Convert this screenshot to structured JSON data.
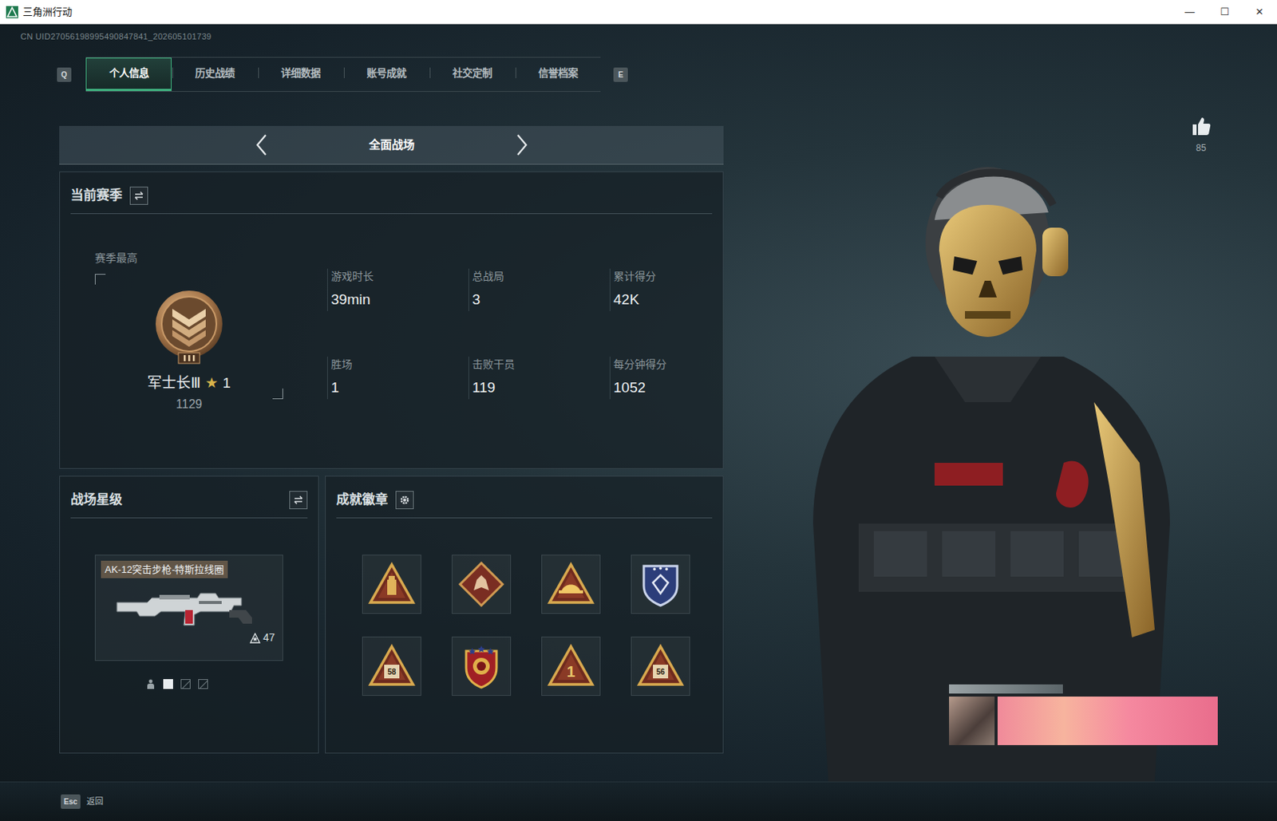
{
  "window": {
    "title": "三角洲行动",
    "controls": [
      "—",
      "☐",
      "✕"
    ]
  },
  "uid": "CN UID27056198995490847841_202605101739",
  "tabs": {
    "prev_key": "Q",
    "next_key": "E",
    "items": [
      {
        "label": "个人信息",
        "selected": true
      },
      {
        "label": "历史战绩",
        "selected": false
      },
      {
        "label": "详细数据",
        "selected": false
      },
      {
        "label": "账号成就",
        "selected": false
      },
      {
        "label": "社交定制",
        "selected": false
      },
      {
        "label": "信誉档案",
        "selected": false
      }
    ]
  },
  "mode": {
    "label": "全面战场"
  },
  "season": {
    "title": "当前赛季",
    "best_label": "赛季最高",
    "rank": "军士长Ⅲ",
    "rank_star_glyph": "★",
    "rank_star_count": "1",
    "score": "1129",
    "stats": [
      {
        "label": "游戏时长",
        "value": "39min"
      },
      {
        "label": "总战局",
        "value": "3"
      },
      {
        "label": "累计得分",
        "value": "42K"
      },
      {
        "label": "胜场",
        "value": "1"
      },
      {
        "label": "击败干员",
        "value": "119"
      },
      {
        "label": "每分钟得分",
        "value": "1052"
      }
    ]
  },
  "star_level": {
    "title": "战场星级",
    "weapon": "AK-12突击步枪-特斯拉线圈",
    "star_count": "47",
    "pages": [
      {
        "kind": "person",
        "selected": false
      },
      {
        "kind": "square",
        "selected": true
      },
      {
        "kind": "square",
        "selected": false
      },
      {
        "kind": "square",
        "selected": false
      }
    ]
  },
  "badges": {
    "title": "成就徽章",
    "items": [
      {
        "kind": "triangle-bottle"
      },
      {
        "kind": "diamond"
      },
      {
        "kind": "triangle-hat"
      },
      {
        "kind": "shield"
      },
      {
        "kind": "triangle-small-text",
        "text": "58"
      },
      {
        "kind": "crest"
      },
      {
        "kind": "triangle-big-text",
        "text": "1"
      },
      {
        "kind": "triangle-small-text",
        "text": "56"
      }
    ]
  },
  "likes": {
    "count": "85"
  },
  "footer": {
    "key": "Esc",
    "label": "返回"
  }
}
